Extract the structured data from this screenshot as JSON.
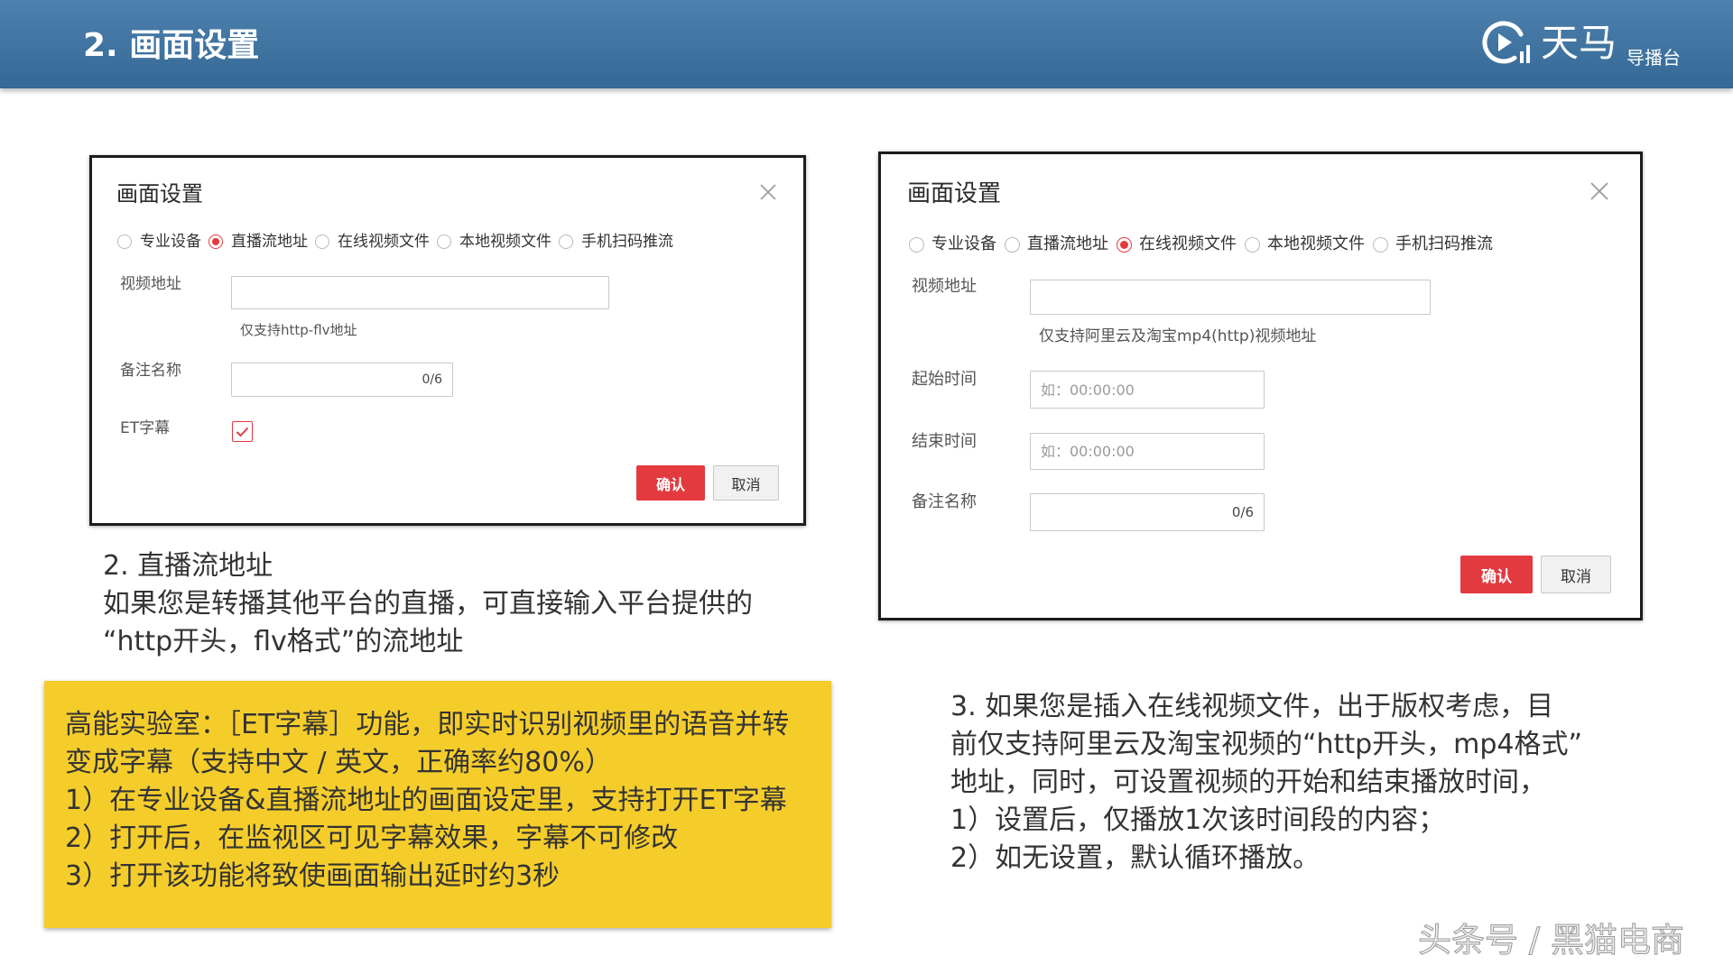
{
  "slide": {
    "title": "2. 画面设置",
    "logo": {
      "icon": "play-circle-signal-icon",
      "name": "天马",
      "subtitle": "导播台"
    }
  },
  "colors": {
    "header_bg": "#3b74a6",
    "accent_red": "#e33a40",
    "note_bg": "#f5cd2b"
  },
  "left_dialog": {
    "title": "画面设置",
    "close_icon": "close-icon",
    "sources": [
      {
        "label": "专业设备",
        "selected": false
      },
      {
        "label": "直播流地址",
        "selected": true
      },
      {
        "label": "在线视频文件",
        "selected": false
      },
      {
        "label": "本地视频文件",
        "selected": false
      },
      {
        "label": "手机扫码推流",
        "selected": false
      }
    ],
    "video_url": {
      "label": "视频地址",
      "value": "",
      "hint": "仅支持http-flv地址"
    },
    "remark": {
      "label": "备注名称",
      "value": "",
      "counter": "0/6"
    },
    "et_subtitle": {
      "label": "ET字幕",
      "checked": true
    },
    "confirm_label": "确认",
    "cancel_label": "取消"
  },
  "right_dialog": {
    "title": "画面设置",
    "close_icon": "close-icon",
    "sources": [
      {
        "label": "专业设备",
        "selected": false
      },
      {
        "label": "直播流地址",
        "selected": false
      },
      {
        "label": "在线视频文件",
        "selected": true
      },
      {
        "label": "本地视频文件",
        "selected": false
      },
      {
        "label": "手机扫码推流",
        "selected": false
      }
    ],
    "video_url": {
      "label": "视频地址",
      "value": "",
      "hint": "仅支持阿里云及淘宝mp4(http)视频地址"
    },
    "start_time": {
      "label": "起始时间",
      "value": "",
      "placeholder": "如：00:00:00"
    },
    "end_time": {
      "label": "结束时间",
      "value": "",
      "placeholder": "如：00:00:00"
    },
    "remark": {
      "label": "备注名称",
      "value": "",
      "counter": "0/6"
    },
    "confirm_label": "确认",
    "cancel_label": "取消"
  },
  "left_caption": {
    "heading": "2. 直播流地址",
    "lines": [
      "如果您是转播其他平台的直播，可直接输入平台提供的",
      "“http开头，flv格式”的流地址"
    ]
  },
  "note": {
    "lines": [
      "高能实验室：［ET字幕］功能，即实时识别视频里的语音并转",
      "变成字幕（支持中文 / 英文，正确率约80%）",
      "1）在专业设备&直播流地址的画面设定里，支持打开ET字幕",
      "2）打开后，在监视区可见字幕效果，字幕不可修改",
      "3）打开该功能将致使画面输出延时约3秒"
    ]
  },
  "right_caption": {
    "lines": [
      "3. 如果您是插入在线视频文件，出于版权考虑，目",
      "前仅支持阿里云及淘宝视频的“http开头，mp4格式”",
      "地址，同时，可设置视频的开始和结束播放时间，",
      "1）设置后，仅播放1次该时间段的内容；",
      "2）如无设置，默认循环播放。"
    ]
  },
  "watermark": "头条号 / 黑猫电商"
}
